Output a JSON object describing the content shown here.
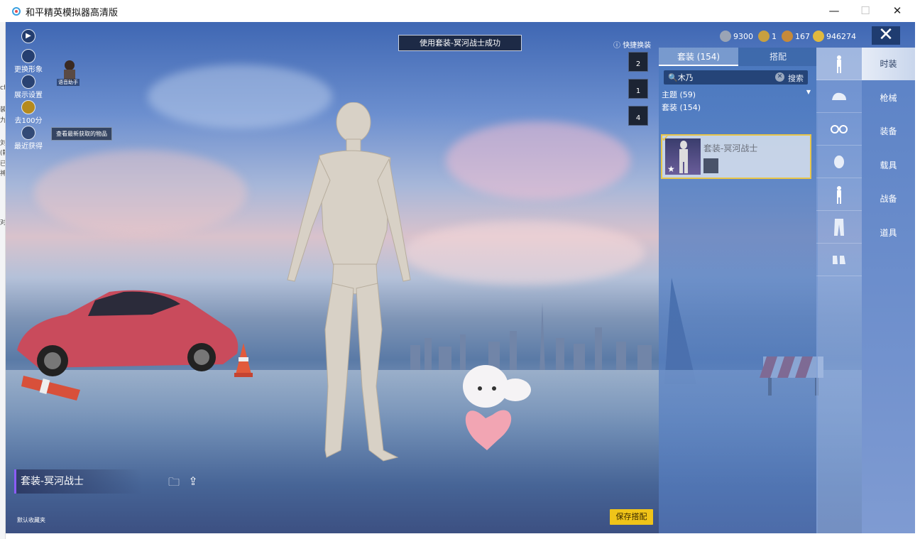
{
  "window": {
    "title": "和平精英模拟器高清版",
    "minimize": "—",
    "maximize": "☐",
    "close": "✕"
  },
  "left_strip_text": [
    "cf",
    "装",
    "九",
    "刘",
    "(韩",
    "已",
    "神",
    "对"
  ],
  "top": {
    "banner": "使用套装-冥河战士成功",
    "currencies": [
      {
        "name": "silver",
        "value": "9300",
        "color": "#9aa4b5"
      },
      {
        "name": "medal",
        "value": "1",
        "color": "#c8a040"
      },
      {
        "name": "bronze",
        "value": "167",
        "color": "#c68a3a"
      },
      {
        "name": "gold",
        "value": "946274",
        "color": "#e0b93e"
      }
    ],
    "close_label": "✕"
  },
  "quick_change": {
    "label": "快捷换装",
    "slots": [
      "2",
      "1",
      "4"
    ]
  },
  "left_menu": {
    "items": [
      {
        "label": "更换形象"
      },
      {
        "label": "展示设置"
      },
      {
        "label": "去100分"
      },
      {
        "label": "最近获得"
      }
    ],
    "voice_assistant": "语音助手",
    "new_items_tip": "查看最新获取的物品"
  },
  "panel": {
    "tabs": [
      "套装 (154)",
      "搭配"
    ],
    "search": {
      "value": "木乃",
      "button": "搜索"
    },
    "theme_row": "主题 (59)",
    "suits_row": "套装 (154)",
    "selected_item": "套装-冥河战士"
  },
  "categories": [
    "outfit-icon",
    "hat-icon",
    "goggles-icon",
    "face-icon",
    "body-icon",
    "pants-icon",
    "shoes-icon"
  ],
  "nav": [
    "时装",
    "枪械",
    "装备",
    "载具",
    "战备",
    "道具"
  ],
  "bottom": {
    "outfit_name": "套装-冥河战士",
    "default_fav": "默认收藏夹",
    "save": "保存搭配"
  },
  "colors": {
    "accent_gold": "#f0c419",
    "selected_border": "#e8c548",
    "nav_active": "#e6ecf7"
  }
}
